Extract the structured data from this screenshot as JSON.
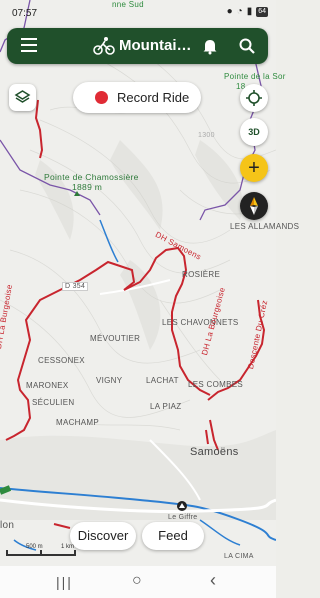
{
  "status": {
    "time": "07:57",
    "battery": "64"
  },
  "app": {
    "title": "Mountain…"
  },
  "record": {
    "label": "Record Ride"
  },
  "compass_mode": {
    "label": "3D"
  },
  "buttons": {
    "explore": "Discover",
    "feed": "Feed"
  },
  "scale": {
    "m": "500 m",
    "km": "1 km"
  },
  "places": {
    "sud": "nne Sud",
    "pointe_right": "Pointe de la Sor",
    "pointe_right_alt": "18",
    "elev1300": "1300",
    "chamossiere": "Pointe de Chamossière",
    "chamossiere_alt": "1889 m",
    "allamands": "LES ALLAMANDS",
    "d354": "D 354",
    "rosiere": "ROSIÈRE",
    "chavonnets": "LES CHAVONNETS",
    "mevoutier": "MÉVOUTIER",
    "cessonex": "CESSONEX",
    "vigny": "VIGNY",
    "lachat": "LACHAT",
    "maronex": "MARONEX",
    "combe": "LES COMBES",
    "seculien": "SÉCULIEN",
    "lapiaz": "LA PIAZ",
    "machamp": "MACHAMP",
    "samoens": "Samoëns",
    "giffre": "Le Giffre",
    "lon": "lon",
    "lacima": "LA CIMA"
  },
  "trails": {
    "burgeoise": "DH La Burgeoise",
    "samoens": "DH Samoens",
    "bourgeoise2": "DH La Bourgeoise",
    "descente": "Descente Du Créz"
  }
}
